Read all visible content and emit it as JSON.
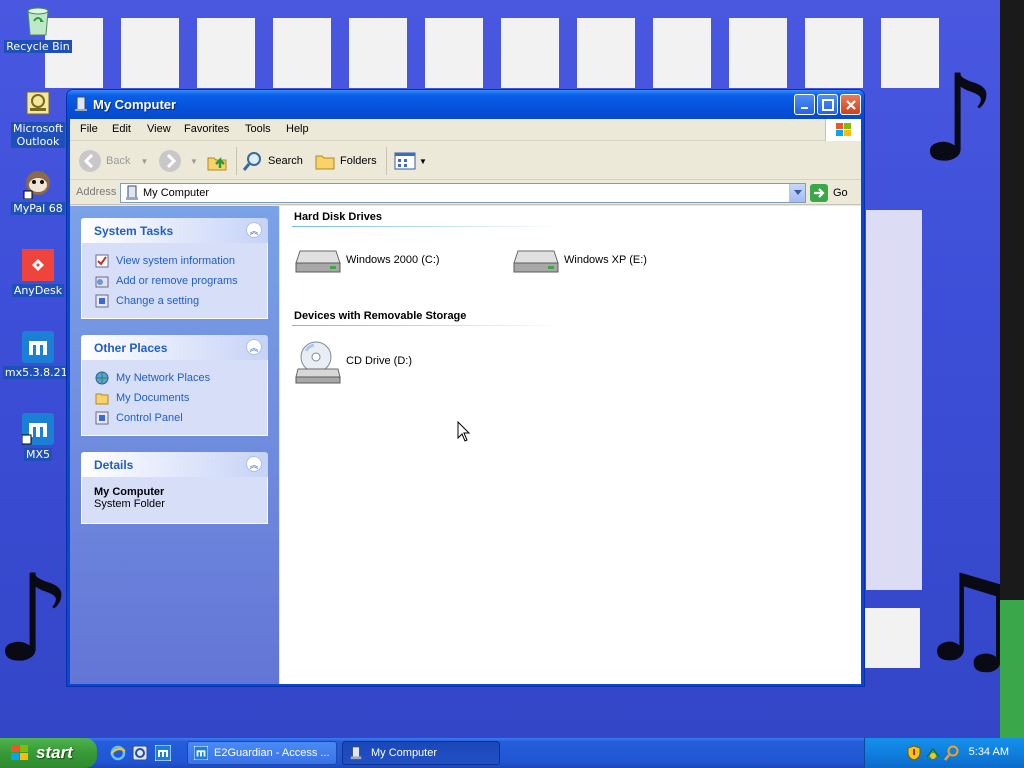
{
  "desktop": {
    "icons": [
      {
        "label": "Recycle Bin",
        "icon": "recycle-bin-icon"
      },
      {
        "label": "Microsoft\nOutlook",
        "label_line1": "Microsoft",
        "label_line2": "Outlook",
        "icon": "outlook-icon"
      },
      {
        "label": "MyPal 68",
        "icon": "mypal-icon"
      },
      {
        "label": "AnyDesk",
        "icon": "anydesk-icon"
      },
      {
        "label": "mx5.3.8.21.",
        "icon": "maxthon-icon"
      },
      {
        "label": "MX5",
        "icon": "maxthon-icon"
      }
    ]
  },
  "window": {
    "title": "My Computer",
    "menu": [
      "File",
      "Edit",
      "View",
      "Favorites",
      "Tools",
      "Help"
    ],
    "toolbar": {
      "back": "Back",
      "search": "Search",
      "folders": "Folders"
    },
    "address": {
      "label": "Address",
      "value": "My Computer",
      "go": "Go"
    },
    "panels": {
      "system_tasks": {
        "title": "System Tasks",
        "items": [
          "View system information",
          "Add or remove programs",
          "Change a setting"
        ]
      },
      "other_places": {
        "title": "Other Places",
        "items": [
          "My Network Places",
          "My Documents",
          "Control Panel"
        ]
      },
      "details": {
        "title": "Details",
        "name": "My Computer",
        "type": "System Folder"
      }
    },
    "groups": {
      "hard_disks": {
        "title": "Hard Disk Drives",
        "items": [
          "Windows 2000 (C:)",
          "Windows XP (E:)"
        ]
      },
      "removable": {
        "title": "Devices with Removable Storage",
        "items": [
          "CD Drive (D:)"
        ]
      }
    }
  },
  "taskbar": {
    "start": "start",
    "tasks": [
      "E2Guardian - Access ...",
      "My Computer"
    ],
    "clock": "5:34 AM"
  },
  "colors": {
    "accent": "#0a47d6",
    "link": "#215dc6",
    "start_green": "#379a37"
  }
}
